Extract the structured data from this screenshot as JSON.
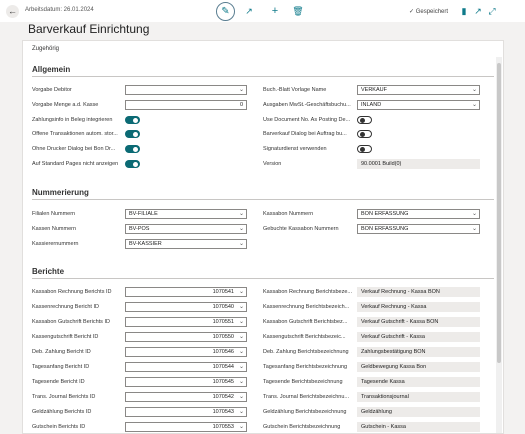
{
  "header": {
    "work_date": "Arbeitsdatum: 26.01.2024",
    "title": "Barverkauf Einrichtung",
    "saved_label": "Gespeichert",
    "accent_color": "#0b6a74"
  },
  "tabs": {
    "related": "Zugehörig"
  },
  "allgemein": {
    "title": "Allgemein",
    "vorgabe_debitor": {
      "label": "Vorgabe Debitor",
      "value": ""
    },
    "vorgabe_menge": {
      "label": "Vorgabe Menge a.d. Kasse",
      "value": "0"
    },
    "zahlungsinfo": {
      "label": "Zahlungsinfo in Beleg integrieren",
      "on": true
    },
    "offene_trans": {
      "label": "Offene Transaktionen autom. stor...",
      "on": true
    },
    "ohne_drucker": {
      "label": "Ohne Drucker Dialog bei Bon Dr...",
      "on": true
    },
    "auf_standard": {
      "label": "Auf Standard Pages nicht anzeigen",
      "on": true
    },
    "buch_blatt": {
      "label": "Buch.-Blatt Vorlage Name",
      "value": "VERKAUF"
    },
    "ausgaben_mwst": {
      "label": "Ausgaben MwSt.-Geschäftsbuchu...",
      "value": "INLAND"
    },
    "use_document": {
      "label": "Use Document No. As Posting De...",
      "on": false
    },
    "barverkauf_dialog": {
      "label": "Barverkauf Dialog bei Auftrag bu...",
      "on": false
    },
    "signaturdienst": {
      "label": "Signaturdienst verwenden",
      "on": false
    },
    "version": {
      "label": "Version",
      "value": "90.0001 Build(0)"
    }
  },
  "nummerierung": {
    "title": "Nummerierung",
    "filialen": {
      "label": "Filialen Nummern",
      "value": "BV-FILIALE"
    },
    "kassen": {
      "label": "Kassen Nummern",
      "value": "BV-POS"
    },
    "kassierer": {
      "label": "Kassierernummern",
      "value": "BV-KASSIER"
    },
    "kassabon": {
      "label": "Kassabon Nummern",
      "value": "BON ERFASSUNG"
    },
    "gebuchte_kassabon": {
      "label": "Gebuchte Kassabon Nummern",
      "value": "BON ERFASSUNG"
    }
  },
  "berichte": {
    "title": "Berichte",
    "left": [
      {
        "label": "Kassabon Rechnung Berichts ID",
        "value": "1070541"
      },
      {
        "label": "Kassenrechnung Bericht ID",
        "value": "1070540"
      },
      {
        "label": "Kassabon Gutschrift Berichts ID",
        "value": "1070551"
      },
      {
        "label": "Kassengutschrift Bericht ID",
        "value": "1070550"
      },
      {
        "label": "Deb. Zahlung Bericht ID",
        "value": "1070546"
      },
      {
        "label": "Tagesanfang Bericht ID",
        "value": "1070544"
      },
      {
        "label": "Tagesende Bericht ID",
        "value": "1070545"
      },
      {
        "label": "Trans. Journal Berichts ID",
        "value": "1070542"
      },
      {
        "label": "Geldzählung Berichts ID",
        "value": "1070543"
      },
      {
        "label": "Gutschein Berichts ID",
        "value": "1070553"
      }
    ],
    "right": [
      {
        "label": "Kassabon Rechnung Berichtsbeze...",
        "value": "Verkauf Rechnung - Kassa BON"
      },
      {
        "label": "Kassenrechnung Berichtsbezeich...",
        "value": "Verkauf Rechnung - Kassa"
      },
      {
        "label": "Kassabon Gutschrift Berichtsbez...",
        "value": "Verkauf Gutschrift - Kassa BON"
      },
      {
        "label": "Kassengutschrift Berichtsbezeic...",
        "value": "Verkauf Gutschrift - Kassa"
      },
      {
        "label": "Deb. Zahlung Berichtsbezeichnung",
        "value": "Zahlungsbestätigung BON"
      },
      {
        "label": "Tagesanfang Berichtsbezeichnung",
        "value": "Geldbewegung Kassa Bon"
      },
      {
        "label": "Tagesende Berichtsbezeichnung",
        "value": "Tagesende Kassa"
      },
      {
        "label": "Trans. Journal Berichtsbezeichnu...",
        "value": "Transaktionsjournal"
      },
      {
        "label": "Geldzählung Berichtsbezeichnung",
        "value": "Geldzählung"
      },
      {
        "label": "Gutschein Berichtsbezeichnung",
        "value": "Gutschein - Kassa"
      }
    ]
  }
}
